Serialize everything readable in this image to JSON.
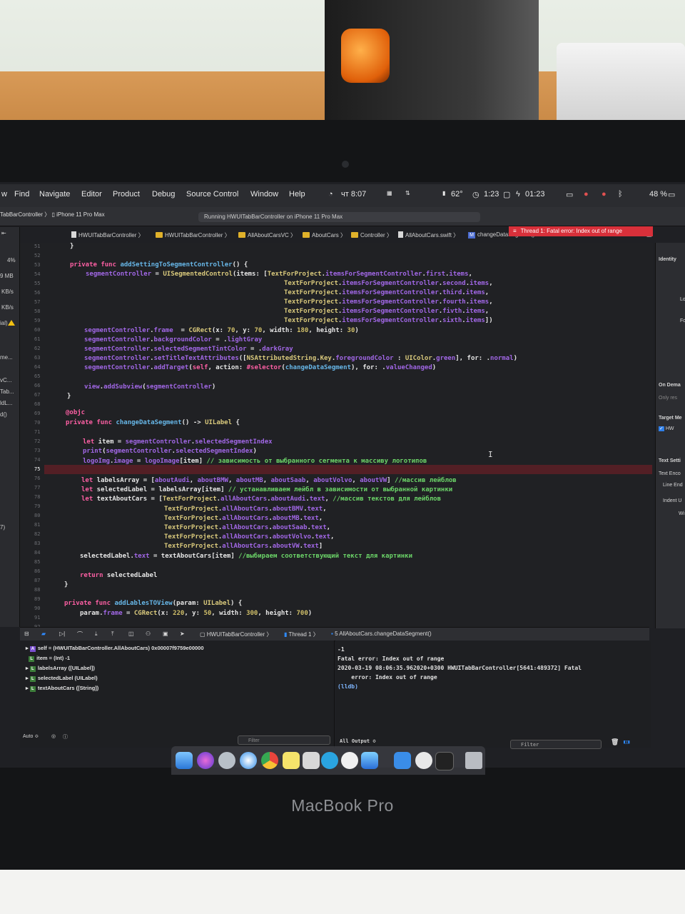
{
  "menubar": {
    "items": [
      "Find",
      "Navigate",
      "Editor",
      "Product",
      "Debug",
      "Source Control",
      "Window",
      "Help"
    ],
    "clock": "чт 8:07",
    "time_left": "1:23",
    "timer": "01:23",
    "temp": "62°",
    "battery": "48 %"
  },
  "toolbar": {
    "scheme": "TabBarController",
    "device": "iPhone 11 Pro Max",
    "activity": "Running HWUITabBarController on iPhone 11 Pro Max"
  },
  "jumpbar": {
    "crumbs": [
      "HWUITabBarController",
      "HWUITabBarController",
      "AllAboutCarsVC",
      "AboutCars",
      "Controller",
      "AllAboutCars.swift",
      "changeDataSegment()"
    ]
  },
  "navigator": {
    "items": [
      "4%",
      "9 MB",
      "KB/s",
      "KB/s",
      "ial)",
      "me...",
      "vC...",
      "Tab...",
      "ldL...",
      "d()",
      "7)"
    ]
  },
  "editor": {
    "line_numbers": [
      "51",
      "52",
      "53",
      "54",
      "55",
      "56",
      "57",
      "58",
      "59",
      "60",
      "61",
      "62",
      "63",
      "64",
      "65",
      "66",
      "67",
      "68",
      "69",
      "70",
      "71",
      "72",
      "73",
      "74",
      "75",
      "76",
      "77",
      "78",
      "79",
      "80",
      "81",
      "82",
      "83",
      "84",
      "85",
      "86",
      "87",
      "88",
      "89",
      "90",
      "91",
      "92"
    ],
    "error_text": "Thread 1: Fatal error: Index out of range"
  },
  "inspector": {
    "items": [
      "Identity",
      "Lo",
      "Fo",
      "On Dema",
      "Only res",
      "Target Me",
      "HW",
      "Text Setti",
      "Text Enco",
      "Line End",
      "Indent U",
      "Wi"
    ]
  },
  "debugbar": {
    "scheme": "HWUITabBarController",
    "thread": "Thread 1",
    "frame": "5 AllAboutCars.changeDataSegment()"
  },
  "variables": [
    {
      "icon": "A",
      "text": "self = (HWUITabBarController.AllAboutCars) 0x00007f9759e00000"
    },
    {
      "icon": "L",
      "text": "item = (Int) -1"
    },
    {
      "icon": "L",
      "text": "labelsArray ([UILabel])"
    },
    {
      "icon": "L",
      "text": "selectedLabel (UILabel)"
    },
    {
      "icon": "L",
      "text": "textAboutCars ([String])"
    }
  ],
  "console": {
    "lines": [
      "-1",
      "Fatal error: Index out of range",
      "2020-03-19 08:06:35.962020+0300 HWUITabBarController[5641:489372] Fatal",
      "    error: Index out of range",
      "(lldb)"
    ],
    "filter_placeholder": "Filter",
    "output_selector": "All Output ≎"
  },
  "vars_footer": {
    "mode": "Auto ≎",
    "filter_placeholder": "Filter"
  },
  "laptop": {
    "brand": "MacBook Pro"
  },
  "colors": {
    "keyword": "#fc5fa3",
    "function": "#67b7e8",
    "comment": "#6bd468",
    "error": "#d8303a"
  }
}
